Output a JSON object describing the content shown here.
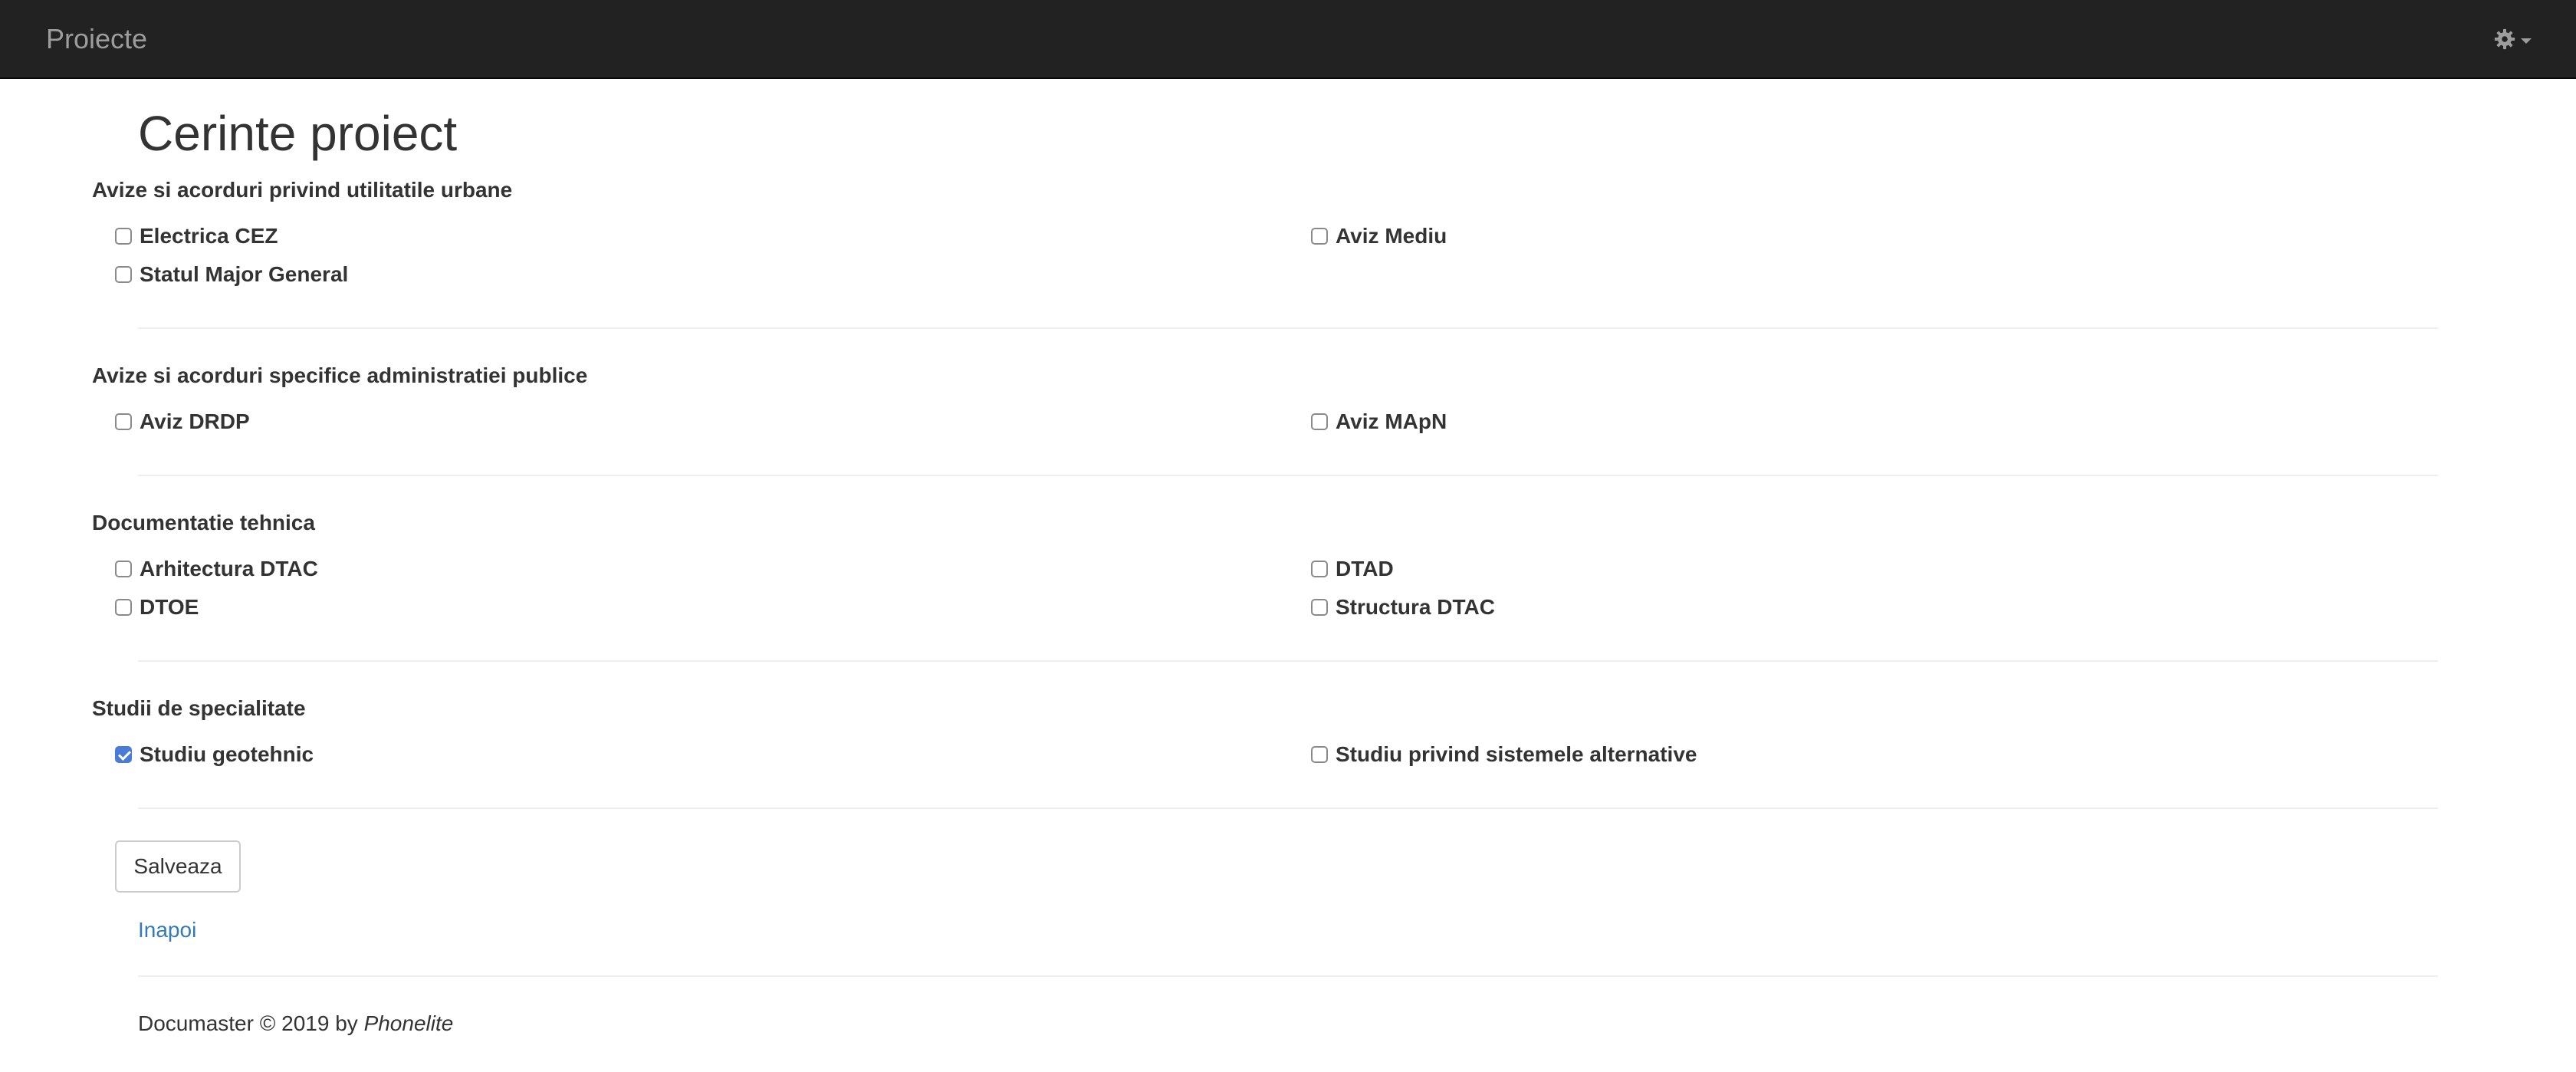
{
  "navbar": {
    "brand": "Proiecte",
    "settings_icon": "gear-icon"
  },
  "page_title": "Cerinte proiect",
  "sections": [
    {
      "title": "Avize si acorduri privind utilitatile urbane",
      "items": [
        {
          "label": "Electrica CEZ",
          "checked": false
        },
        {
          "label": "Aviz Mediu",
          "checked": false
        },
        {
          "label": "Statul Major General",
          "checked": false
        }
      ]
    },
    {
      "title": "Avize si acorduri specifice administratiei publice",
      "items": [
        {
          "label": "Aviz DRDP",
          "checked": false
        },
        {
          "label": "Aviz MApN",
          "checked": false
        }
      ]
    },
    {
      "title": "Documentatie tehnica",
      "items": [
        {
          "label": "Arhitectura DTAC",
          "checked": false
        },
        {
          "label": "DTAD",
          "checked": false
        },
        {
          "label": "DTOE",
          "checked": false
        },
        {
          "label": "Structura DTAC",
          "checked": false
        }
      ]
    },
    {
      "title": "Studii de specialitate",
      "items": [
        {
          "label": "Studiu geotehnic",
          "checked": true
        },
        {
          "label": "Studiu privind sistemele alternative",
          "checked": false
        }
      ]
    }
  ],
  "actions": {
    "save_label": "Salveaza",
    "back_label": "Inapoi"
  },
  "footer": {
    "text": "Documaster © 2019 by",
    "author": "Phonelite"
  },
  "colors": {
    "navbar_bg": "#222222",
    "link": "#337ab7",
    "checkbox_checked": "#4a7bd8"
  }
}
